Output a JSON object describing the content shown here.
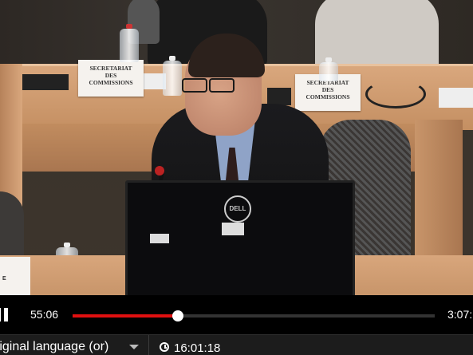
{
  "video": {
    "name_cards": [
      {
        "line1": "SECRETARIAT",
        "line2": "DES",
        "line3": "COMMISSIONS"
      },
      {
        "line1": "SECRETARIAT",
        "line2": "DES",
        "line3": "COMMISSIONS"
      }
    ],
    "left_card_text": "E",
    "monitor_logo": "DELL"
  },
  "player": {
    "current_time": "55:06",
    "duration": "3:07:",
    "progress": 0.29
  },
  "bottom_bar": {
    "language": "riginal language (or)",
    "clock_time": "16:01:18"
  }
}
